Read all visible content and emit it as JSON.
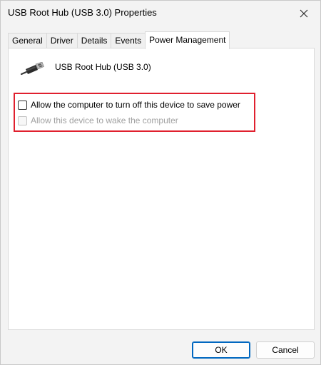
{
  "window": {
    "title": "USB Root Hub (USB 3.0) Properties"
  },
  "tabs": [
    {
      "label": "General",
      "active": false
    },
    {
      "label": "Driver",
      "active": false
    },
    {
      "label": "Details",
      "active": false
    },
    {
      "label": "Events",
      "active": false
    },
    {
      "label": "Power Management",
      "active": true
    }
  ],
  "device": {
    "name": "USB Root Hub (USB 3.0)",
    "icon": "usb-connector-icon"
  },
  "options": [
    {
      "label": "Allow the computer to turn off this device to save power",
      "checked": false,
      "enabled": true
    },
    {
      "label": "Allow this device to wake the computer",
      "checked": false,
      "enabled": false
    }
  ],
  "buttons": {
    "ok_label": "OK",
    "cancel_label": "Cancel"
  },
  "colors": {
    "highlight_border": "#e0202e",
    "default_button_border": "#0067c0",
    "disabled_text": "#a0a0a0"
  }
}
